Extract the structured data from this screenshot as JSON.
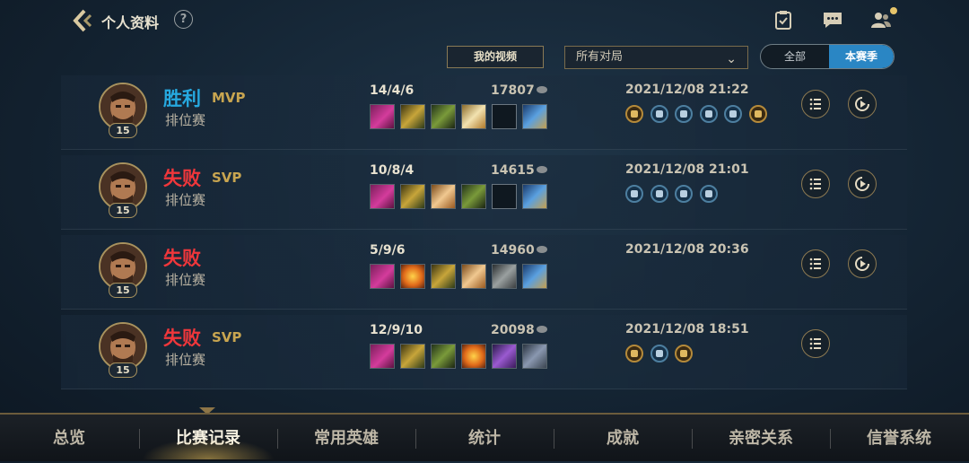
{
  "header": {
    "title": "个人资料",
    "help_label": "?"
  },
  "filters": {
    "video_button": "我的视频",
    "match_dropdown": "所有对局",
    "scope_toggle": [
      "全部",
      "本赛季"
    ],
    "scope_selected": "本赛季"
  },
  "matches": [
    {
      "level": "15",
      "result": "胜利",
      "result_type": "win",
      "badge": "MVP",
      "mode": "排位赛",
      "kda": "14/4/6",
      "gold": "17807",
      "datetime": "2021/12/08 21:22",
      "items": [
        "magenta",
        "gold-green",
        "green",
        "gold-white",
        "empty",
        "blue-gold"
      ],
      "medals": [
        "gold",
        "blue",
        "blue",
        "blue",
        "blue",
        "bronze"
      ],
      "has_replay": true
    },
    {
      "level": "15",
      "result": "失败",
      "result_type": "loss",
      "badge": "SVP",
      "mode": "排位赛",
      "kda": "10/8/4",
      "gold": "14615",
      "datetime": "2021/12/08 21:01",
      "items": [
        "magenta",
        "gold-green",
        "orange-white",
        "green",
        "empty",
        "blue-gold"
      ],
      "medals": [
        "blue",
        "blue",
        "blue",
        "blue"
      ],
      "has_replay": true
    },
    {
      "level": "15",
      "result": "失败",
      "result_type": "loss",
      "badge": "",
      "mode": "排位赛",
      "kda": "5/9/6",
      "gold": "14960",
      "datetime": "2021/12/08 20:36",
      "items": [
        "magenta",
        "orange",
        "gold-green",
        "orange-white",
        "gray",
        "blue-gold"
      ],
      "medals": [],
      "has_replay": true
    },
    {
      "level": "15",
      "result": "失败",
      "result_type": "loss",
      "badge": "SVP",
      "mode": "排位赛",
      "kda": "12/9/10",
      "gold": "20098",
      "datetime": "2021/12/08 18:51",
      "items": [
        "magenta",
        "gold-green",
        "green",
        "orange",
        "purple",
        "gray-blue"
      ],
      "medals": [
        "gold",
        "blue",
        "bronze"
      ],
      "has_replay": false
    }
  ],
  "bottom_nav": {
    "tabs": [
      "总览",
      "比赛记录",
      "常用英雄",
      "统计",
      "成就",
      "亲密关系",
      "信誉系统"
    ],
    "active": "比赛记录"
  },
  "colors": {
    "win": "#26a9e0",
    "loss": "#f0373b",
    "badge": "#c8a550",
    "accent": "#2a86c4"
  }
}
